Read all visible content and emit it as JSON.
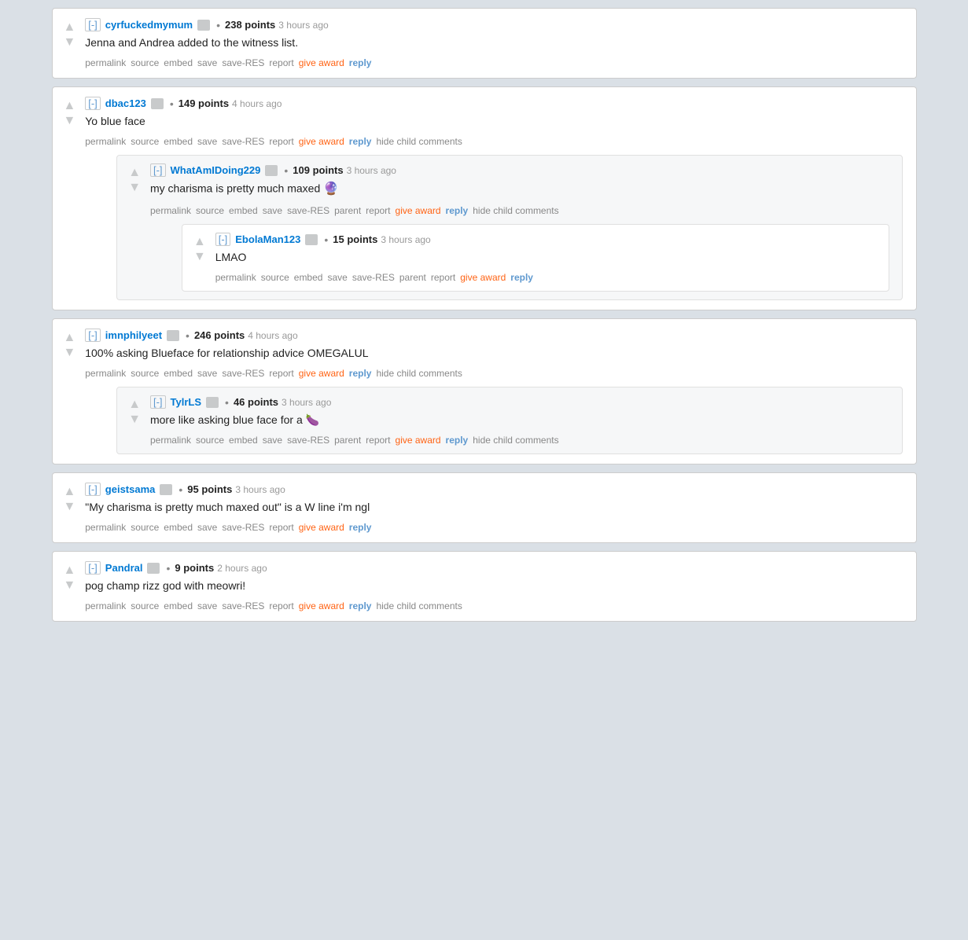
{
  "comments": [
    {
      "id": "comment-1",
      "collapse": "[-]",
      "username": "cyrfuckedmymum",
      "points": "238 points",
      "timestamp": "3 hours ago",
      "text": "Jenna and Andrea added to the witness list.",
      "actions": [
        "permalink",
        "source",
        "embed",
        "save",
        "save-RES",
        "report"
      ],
      "give_award": "give award",
      "reply": "reply",
      "hide_child": null,
      "children": []
    },
    {
      "id": "comment-2",
      "collapse": "[-]",
      "username": "dbac123",
      "points": "149 points",
      "timestamp": "4 hours ago",
      "text": "Yo blue face",
      "actions": [
        "permalink",
        "source",
        "embed",
        "save",
        "save-RES",
        "report"
      ],
      "give_award": "give award",
      "reply": "reply",
      "hide_child": "hide child comments",
      "children": [
        {
          "id": "comment-2-1",
          "collapse": "[-]",
          "username": "WhatAmIDoing229",
          "points": "109 points",
          "timestamp": "3 hours ago",
          "text": "my charisma is pretty much maxed",
          "emoji": "🔮",
          "actions": [
            "permalink",
            "source",
            "embed",
            "save",
            "save-RES",
            "parent",
            "report"
          ],
          "give_award": "give award",
          "reply": "reply",
          "hide_child": "hide child comments",
          "children": [
            {
              "id": "comment-2-1-1",
              "collapse": "[-]",
              "username": "EbolaMan123",
              "points": "15 points",
              "timestamp": "3 hours ago",
              "text": "LMAO",
              "actions": [
                "permalink",
                "source",
                "embed",
                "save",
                "save-RES",
                "parent",
                "report"
              ],
              "give_award": "give award",
              "reply": "reply",
              "hide_child": null,
              "children": []
            }
          ]
        }
      ]
    },
    {
      "id": "comment-3",
      "collapse": "[-]",
      "username": "imnphilyeet",
      "points": "246 points",
      "timestamp": "4 hours ago",
      "text": "100% asking Blueface for relationship advice OMEGALUL",
      "actions": [
        "permalink",
        "source",
        "embed",
        "save",
        "save-RES",
        "report"
      ],
      "give_award": "give award",
      "reply": "reply",
      "hide_child": "hide child comments",
      "children": [
        {
          "id": "comment-3-1",
          "collapse": "[-]",
          "username": "TylrLS",
          "points": "46 points",
          "timestamp": "3 hours ago",
          "text": "more like asking blue face for a 🍆",
          "actions": [
            "permalink",
            "source",
            "embed",
            "save",
            "save-RES",
            "parent",
            "report"
          ],
          "give_award": "give award",
          "reply": "reply",
          "hide_child": "hide child comments",
          "children": []
        }
      ]
    },
    {
      "id": "comment-4",
      "collapse": "[-]",
      "username": "geistsama",
      "points": "95 points",
      "timestamp": "3 hours ago",
      "text": "\"My charisma is pretty much maxed out\" is a W line i'm ngl",
      "actions": [
        "permalink",
        "source",
        "embed",
        "save",
        "save-RES",
        "report"
      ],
      "give_award": "give award",
      "reply": "reply",
      "hide_child": null,
      "children": []
    },
    {
      "id": "comment-5",
      "collapse": "[-]",
      "username": "Pandral",
      "points": "9 points",
      "timestamp": "2 hours ago",
      "text": "pog champ rizz god with meowri!",
      "actions": [
        "permalink",
        "source",
        "embed",
        "save",
        "save-RES",
        "report"
      ],
      "give_award": "give award",
      "reply": "reply",
      "hide_child": "hide child comments",
      "children": []
    }
  ],
  "labels": {
    "permalink": "permalink",
    "source": "source",
    "embed": "embed",
    "save": "save",
    "save-RES": "save-RES",
    "report": "report",
    "parent": "parent",
    "give_award": "give award",
    "reply": "reply",
    "hide_child": "hide child comments",
    "collapse": "[-]"
  }
}
